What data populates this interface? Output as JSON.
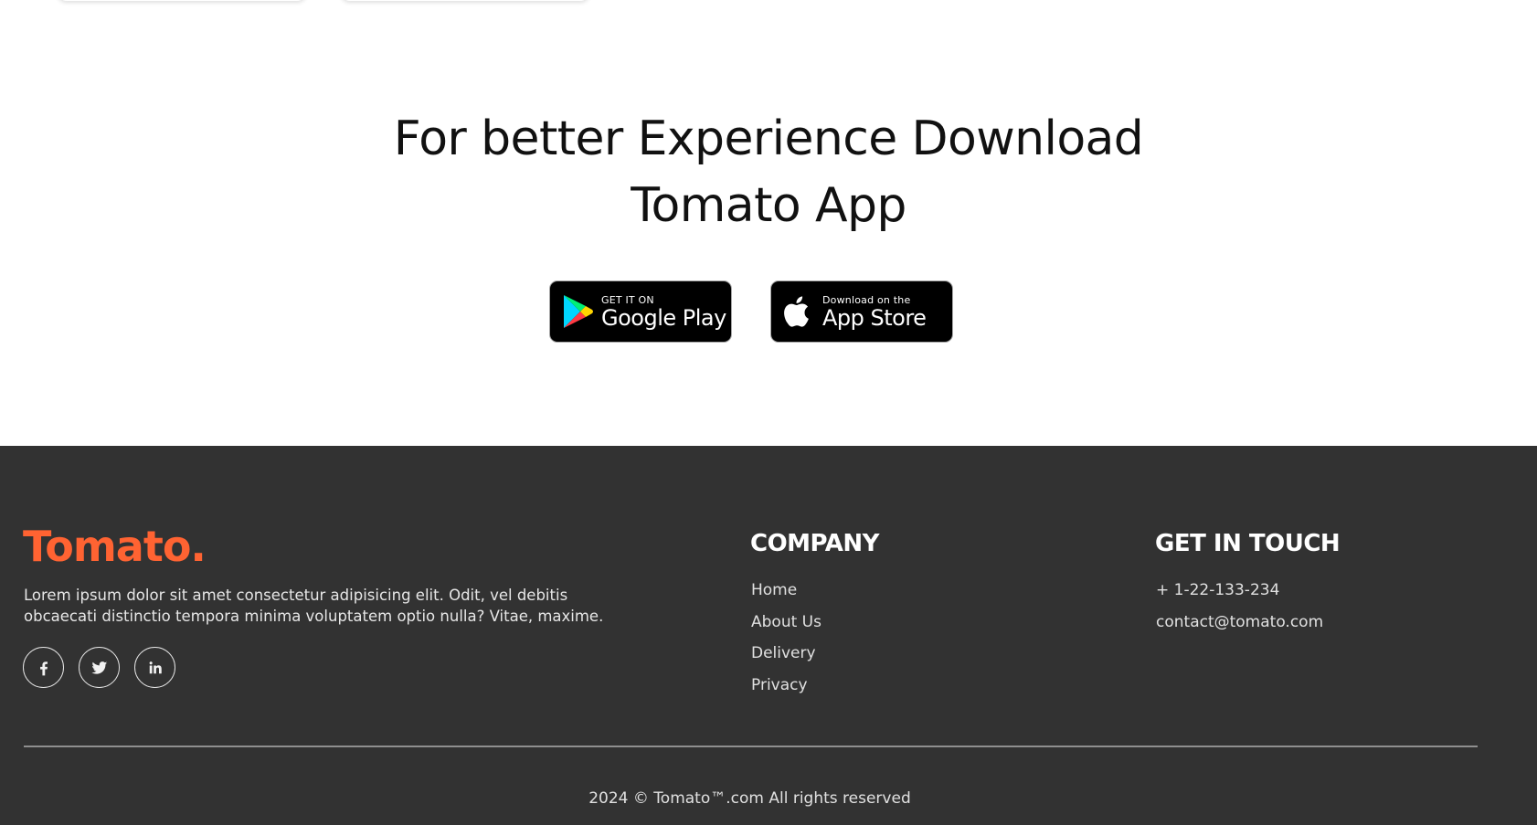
{
  "app_download": {
    "title_line1": "For better Experience Download",
    "title_line2": "Tomato App",
    "google_play": {
      "small": "GET IT ON",
      "big": "Google Play"
    },
    "app_store": {
      "small": "Download on the",
      "big": "App Store"
    }
  },
  "footer": {
    "brand": "Tomato.",
    "brand_color": "#ff6332",
    "background_color": "#323232",
    "about": "Lorem ipsum dolor sit amet consectetur adipisicing elit. Odit, vel debitis obcaecati distinctio tempora minima voluptatem optio nulla? Vitae, maxime.",
    "socials": [
      {
        "icon": "facebook-icon"
      },
      {
        "icon": "twitter-icon"
      },
      {
        "icon": "linkedin-icon"
      }
    ],
    "company": {
      "title": "COMPANY",
      "links": [
        "Home",
        "About Us",
        "Delivery",
        "Privacy"
      ]
    },
    "get_in_touch": {
      "title": "GET IN TOUCH",
      "items": [
        "+ 1-22-133-234",
        "contact@tomato.com"
      ]
    },
    "copyright": "2024 © Tomato™.com All rights reserved"
  }
}
